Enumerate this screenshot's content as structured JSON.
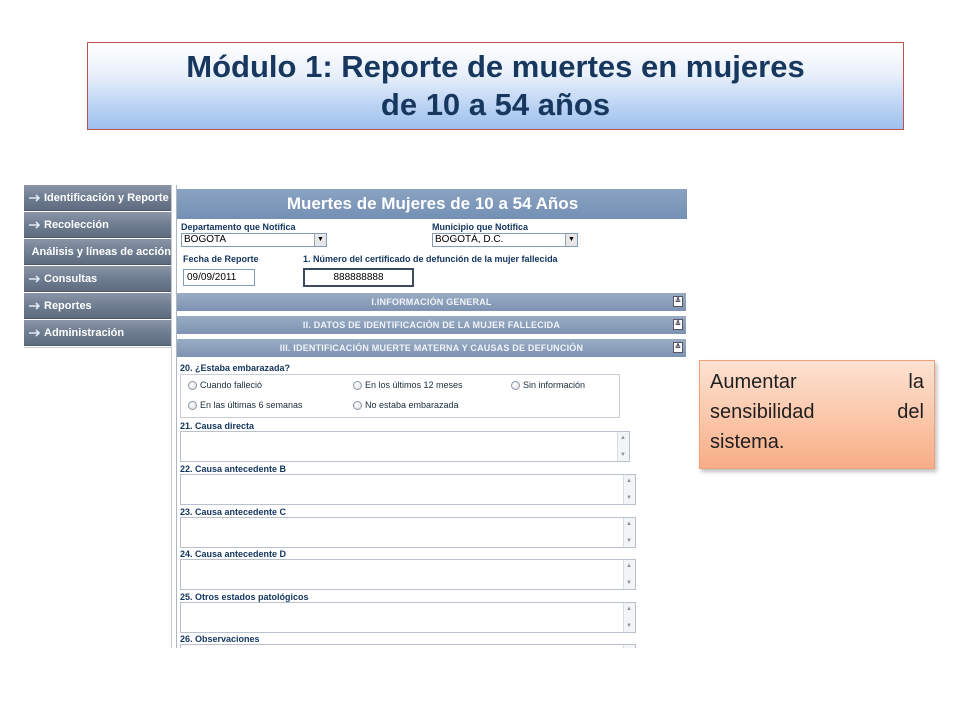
{
  "slide": {
    "title_line1": "Módulo 1: Reporte de muertes en mujeres",
    "title_line2": "de 10  a 54 años"
  },
  "sidebar": {
    "items": [
      {
        "label": "Identificación y Reporte",
        "icon": "arrow-right-icon"
      },
      {
        "label": "Recolección",
        "icon": "arrow-right-icon"
      },
      {
        "label": "Análisis y líneas de acción",
        "icon": "arrow-right-icon"
      },
      {
        "label": "Consultas",
        "icon": "arrow-right-icon"
      },
      {
        "label": "Reportes",
        "icon": "arrow-right-icon"
      },
      {
        "label": "Administración",
        "icon": "arrow-right-icon"
      }
    ]
  },
  "form": {
    "header": "Muertes de Mujeres de 10 a 54 Años",
    "departamento_label": "Departamento que Notifica",
    "departamento_value": "BOGOTA",
    "municipio_label": "Municipio que Notifica",
    "municipio_value": "BOGOTÁ, D.C.",
    "fecha_label": "Fecha de Reporte",
    "fecha_value": "09/09/2011",
    "certificado_label": "1. Número del certificado de defunción de la mujer fallecida",
    "certificado_value": "888888888",
    "sections": [
      {
        "label": "I.INFORMACIÓN GENERAL",
        "toggle": "expand"
      },
      {
        "label": "II. DATOS DE IDENTIFICACIÓN DE LA MUJER FALLECIDA",
        "toggle": "expand"
      },
      {
        "label": "III. IDENTIFICACIÓN MUERTE MATERNA Y CAUSAS DE DEFUNCIÓN",
        "toggle": "collapse"
      }
    ],
    "q20_label": "20. ¿Estaba embarazada?",
    "q20_options": [
      "Cuando falleció",
      "En los últimos 12 meses",
      "Sin información",
      "En las últimas 6 semanas",
      "No estaba embarazada"
    ],
    "q21_label": "21. Causa directa",
    "q22_label": "22. Causa antecedente B",
    "q23_label": "23. Causa antecedente C",
    "q24_label": "24. Causa antecedente D",
    "q25_label": "25. Otros estados patológicos",
    "q26_label": "26. Observaciones"
  },
  "callout": {
    "text": "Aumentar la sensibilidad del sistema."
  },
  "colors": {
    "title_text": "#17375e",
    "title_border": "#c0504d",
    "nav_bg": "#6f7d91",
    "form_header_bg": "#7390b4",
    "label_text": "#12345e",
    "callout_bg": "#fbc6a9"
  }
}
